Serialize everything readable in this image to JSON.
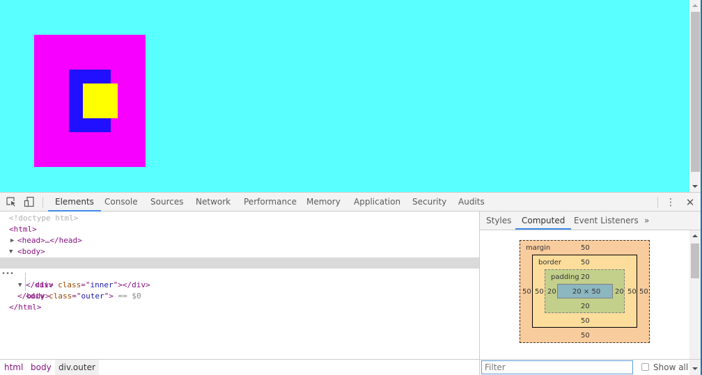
{
  "viewport": {
    "background": "#59ffff",
    "outer_color": "#f700ff",
    "inner_color": "#2010ff",
    "inner2_color": "#ffff00"
  },
  "toolbar": {
    "inspect_icon": "inspect-element-icon",
    "device_icon": "device-toggle-icon",
    "tabs": [
      {
        "label": "Elements",
        "active": true
      },
      {
        "label": "Console"
      },
      {
        "label": "Sources"
      },
      {
        "label": "Network"
      },
      {
        "label": "Performance"
      },
      {
        "label": "Memory"
      },
      {
        "label": "Application"
      },
      {
        "label": "Security"
      },
      {
        "label": "Audits"
      }
    ],
    "more_icon": "kebab-menu-icon",
    "close_icon": "close-icon",
    "more_glyph": "⋮",
    "close_glyph": "✕"
  },
  "elements_tree": {
    "doctype": "<!doctype html>",
    "html_open": "<html>",
    "head": "<head>…</head>",
    "body_open": "<body>",
    "div_outer": {
      "tag": "div",
      "attr": "class",
      "value": "outer",
      "suffix": " == $0"
    },
    "div_inner": {
      "tag": "div",
      "attr": "class",
      "value": "inner"
    },
    "div_close": "</div>",
    "body_close": "</body>",
    "html_close": "</html>",
    "dots": "•••"
  },
  "breadcrumb": [
    "html",
    "body",
    "div.outer"
  ],
  "side_tabs": [
    {
      "label": "Styles"
    },
    {
      "label": "Computed",
      "active": true
    },
    {
      "label": "Event Listeners"
    },
    {
      "label": "»"
    }
  ],
  "box_model": {
    "margin": {
      "label": "margin",
      "top": "50",
      "right": "50",
      "bottom": "50",
      "left": "50"
    },
    "border": {
      "label": "border",
      "top": "50",
      "right": "50",
      "bottom": "50",
      "left": "50"
    },
    "padding": {
      "label": "padding",
      "top": "20",
      "right": "20",
      "bottom": "20",
      "left": "20"
    },
    "content": "20 × 50"
  },
  "filter": {
    "placeholder": "Filter",
    "value": "",
    "show_all_label": "Show all",
    "show_all_checked": false
  }
}
